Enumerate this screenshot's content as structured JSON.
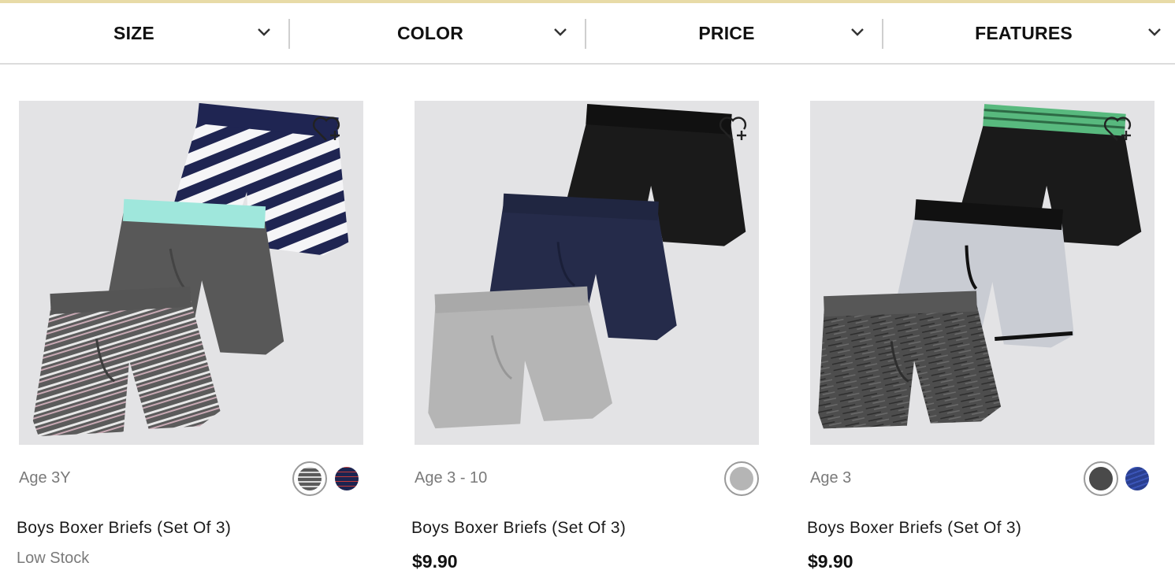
{
  "filters": [
    {
      "label": "SIZE",
      "icon": "chevron-down-icon"
    },
    {
      "label": "COLOR",
      "icon": "chevron-down-icon"
    },
    {
      "label": "PRICE",
      "icon": "chevron-down-icon"
    },
    {
      "label": "FEATURES",
      "icon": "chevron-down-icon"
    }
  ],
  "products": [
    {
      "age": "Age 3Y",
      "name": "Boys Boxer Briefs (Set Of 3)",
      "stock": "Low Stock",
      "price": "",
      "wishlist_icon": "heart-plus-icon",
      "swatches": [
        {
          "name": "gray-stripe",
          "color": "#6e6e6e",
          "selected": true
        },
        {
          "name": "navy-stripe",
          "color": "#1c2450",
          "selected": false
        }
      ]
    },
    {
      "age": "Age 3 - 10",
      "name": "Boys Boxer Briefs (Set Of 3)",
      "stock": "",
      "price": "$9.90",
      "wishlist_icon": "heart-plus-icon",
      "swatches": [
        {
          "name": "light-gray",
          "color": "#b5b5b5",
          "selected": true
        }
      ]
    },
    {
      "age": "Age 3",
      "name": "Boys Boxer Briefs (Set Of 3)",
      "stock": "",
      "price": "$9.90",
      "wishlist_icon": "heart-plus-icon",
      "swatches": [
        {
          "name": "dark-gray",
          "color": "#4a4a4a",
          "selected": true
        },
        {
          "name": "blue",
          "color": "#2a3f8f",
          "selected": false
        }
      ]
    }
  ],
  "colors": {
    "accent_bar": "#e8dba7",
    "image_bg": "#e3e3e5",
    "muted_text": "#7a7a7a"
  }
}
